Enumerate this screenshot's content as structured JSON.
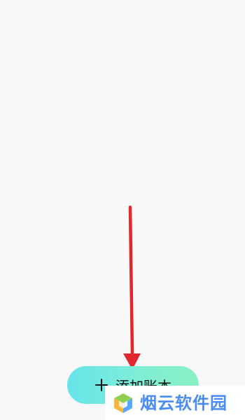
{
  "screen": {
    "button": {
      "icon": "plus-icon",
      "label": "添加账本"
    },
    "overlay": {
      "arrow_color": "#e2272e",
      "watermark_text": "烟云软件园"
    },
    "colors": {
      "background": "#f8f8f8",
      "button_gradient_start": "#67e3ea",
      "button_gradient_end": "#8af0c2",
      "watermark_text": "#4a8df2"
    }
  }
}
